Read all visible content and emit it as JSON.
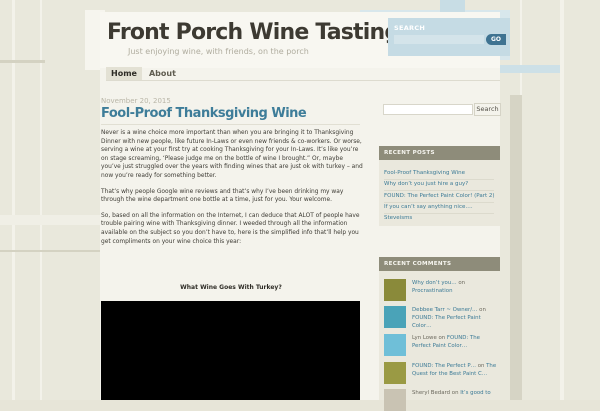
{
  "site": {
    "title": "Front Porch Wine Tasting",
    "tagline": "Just enjoying wine, with friends, on the porch"
  },
  "nav": {
    "items": [
      {
        "label": "Home"
      },
      {
        "label": "About"
      }
    ]
  },
  "header_search": {
    "label": "SEARCH",
    "button": "GO"
  },
  "post": {
    "date": "November 20, 2015",
    "title": "Fool-Proof Thanksgiving Wine",
    "paragraphs": [
      "Never is a wine choice more important than when you are bringing it to Thanksgiving Dinner with new people, like future In-Laws or even new friends & co-workers. Or worse, serving a wine at your first try at cooking Thanksgiving for your In-Laws. It’s like you’re on stage screaming, ‘Please judge me on the bottle of wine I brought.”  Or, maybe you’ve just struggled over the years with finding wines that are just ok with turkey – and now you’re ready for something better.",
      "That’s why people Google wine reviews and that’s why I’ve been drinking my way through the wine department one bottle at a time, just for you. Your welcome.",
      "So, based on all the information on the Internet, I can deduce that ALOT of people have trouble pairing wine with Thanksgiving dinner. I weeded through all the information available on the subject so you don’t have to, here is the simplified info that’ll help you get compliments on your wine choice this year:"
    ],
    "subheading": "What Wine Goes With Turkey?"
  },
  "sidebar": {
    "search_button": "Search",
    "recent_posts": {
      "heading": "RECENT POSTS",
      "items": [
        "Fool-Proof Thanksgiving Wine",
        "Why don’t you just hire a guy?",
        "FOUND: The Perfect Paint Color! (Part 2)",
        "If you can’t say anything nice….",
        "Steveisms"
      ]
    },
    "recent_comments": {
      "heading": "RECENT COMMENTS",
      "items": [
        {
          "author": "Why don’t you…",
          "on": "on",
          "post": "Procrastination",
          "avatar_color": "#8a8a3a"
        },
        {
          "author": "Debbee Tarr ~ Owner/…",
          "on": "on",
          "post": "FOUND: The Perfect Paint Color…",
          "avatar_color": "#4aa3b8"
        },
        {
          "author": "Lyn Lowe",
          "on": "on",
          "post": "FOUND: The Perfect Paint Color…",
          "avatar_color": "#6fbfd8"
        },
        {
          "author": "FOUND: The Perfect P…",
          "on": "on",
          "post": "The Quest for the Best Paint C…",
          "avatar_color": "#9a9a44"
        },
        {
          "author": "Sheryl Bedard",
          "on": "on",
          "post": "It’s good to",
          "avatar_color": "#c9c3b3"
        }
      ]
    }
  }
}
